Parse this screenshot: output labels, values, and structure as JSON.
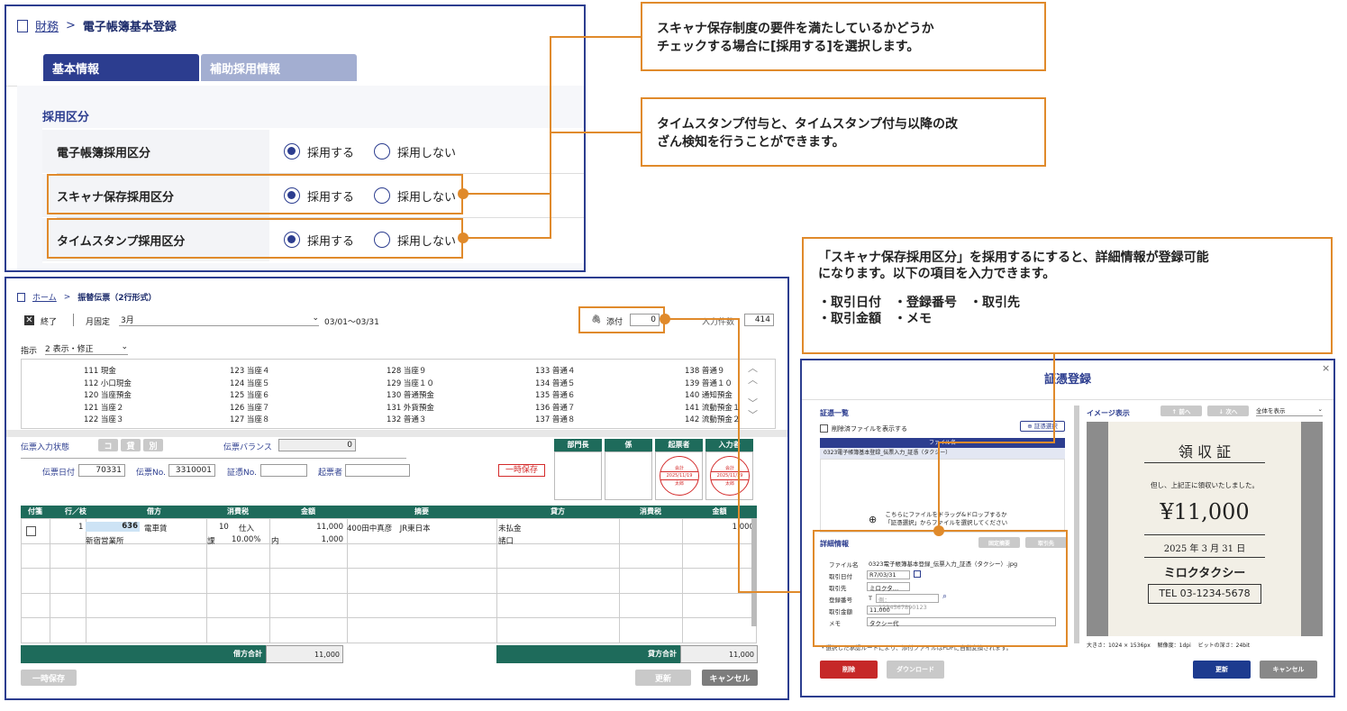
{
  "top_panel": {
    "breadcrumb_parent": "財務",
    "breadcrumb_sep": ">",
    "breadcrumb_current": "電子帳簿基本登録",
    "tabs": [
      "基本情報",
      "補助採用情報"
    ],
    "section_title": "採用区分",
    "rows": [
      {
        "label": "電子帳簿採用区分",
        "opt1": "採用する",
        "opt2": "採用しない"
      },
      {
        "label": "スキャナ保存採用区分",
        "opt1": "採用する",
        "opt2": "採用しない"
      },
      {
        "label": "タイムスタンプ採用区分",
        "opt1": "採用する",
        "opt2": "採用しない"
      }
    ]
  },
  "callouts": {
    "c1": "スキャナ保存制度の要件を満たしているかどうか\nチェックする場合に[採用する]を選択します。",
    "c2": "タイムスタンプ付与と、タイムスタンプ付与以降の改\nざん検知を行うことができます。",
    "c3_line1": "「スキャナ保存採用区分」を採用するにすると、詳細情報が登録可能",
    "c3_line2": "になります。以下の項目を入力できます。",
    "c3_items_line1": "・取引日付　・登録番号　・取引先",
    "c3_items_line2": "・取引金額　・メモ"
  },
  "voucher": {
    "breadcrumb_home": "ホーム",
    "breadcrumb_sep": ">",
    "breadcrumb_current": "振替伝票（2行形式）",
    "end_label": "終了",
    "month_fixed_label": "月固定",
    "month_value": "3月",
    "date_range": "03/01〜03/31",
    "attach_label": "添付",
    "attach_count": "0",
    "input_count_label": "入力件数",
    "input_count": "414",
    "mode_label": "指示",
    "mode_value": "2 表示・修正",
    "accounts": [
      [
        "111 現金",
        "123 当座４",
        "128 当座９",
        "133 普通４",
        "138 普通９"
      ],
      [
        "112 小口現金",
        "124 当座５",
        "129 当座１０",
        "134 普通５",
        "139 普通１０"
      ],
      [
        "120 当座預金",
        "125 当座６",
        "130 普通預金",
        "135 普通６",
        "140 通知預金"
      ],
      [
        "121 当座２",
        "126 当座７",
        "131 外貨預金",
        "136 普通７",
        "141 流動預金１"
      ],
      [
        "122 当座３",
        "127 当座８",
        "132 普通３",
        "137 普通８",
        "142 流動預金２"
      ]
    ],
    "status_label": "伝票入力状態",
    "status_buttons": [
      "コ",
      "貸",
      "別"
    ],
    "balance_label": "伝票バランス",
    "balance_value": "0",
    "date_label": "伝票日付",
    "date_value": "70331",
    "no_label": "伝票No.",
    "no_value": "3310001",
    "evidence_no_label": "証憑No.",
    "originator_label": "起票者",
    "temp_save_tag": "一時保存",
    "approvers": [
      "部門長",
      "係",
      "起票者",
      "入力者"
    ],
    "stamp_date": "2025/11/19",
    "stamp_top": "会計",
    "stamp_bottom": "太郎",
    "table_headers": [
      "付箋",
      "行／枝",
      "借方",
      "消費税",
      "金額",
      "摘要",
      "貸方",
      "消費税",
      "金額"
    ],
    "row": {
      "line": "1",
      "debit_code": "636",
      "debit_name": "電車賃",
      "debit_sub": "新宿営業所",
      "tax_code": "10",
      "tax_type": "仕入",
      "tax_kbn": "課",
      "tax_rate": "10.00%",
      "tax_in": "内",
      "amount": "11,000",
      "amount2": "1,000",
      "memo": "400田中真彦　JR東日本",
      "credit_name": "未払金",
      "credit_sub": "諸口",
      "credit_amount": "1,000"
    },
    "debit_total_label": "借方合計",
    "debit_total": "11,000",
    "credit_total_label": "貸方合計",
    "credit_total": "11,000",
    "btn_temp_save": "一時保存",
    "btn_update": "更新",
    "btn_cancel": "キャンセル"
  },
  "evidence": {
    "title": "証憑登録",
    "list_title": "証憑一覧",
    "show_deleted": "削除済ファイルを表示する",
    "select_btn": "証憑選択",
    "col_file": "ファイル名",
    "file_row": "0323電子帳簿基本登録_伝票入力_証憑（タクシー）",
    "drop_text1": "こちらにファイルをドラッグ&ドロップするか",
    "drop_text2": "「証憑選択」からファイルを選択してください",
    "detail_title": "詳細情報",
    "detail_btn1": "固定摘要",
    "detail_btn2": "取引先",
    "fields": {
      "file_label": "ファイル名",
      "file_value": "0323電子帳簿基本登録_伝票入力_証憑（タクシー）.jpg",
      "date_label": "取引日付",
      "date_value": "R7/03/31",
      "partner_label": "取引先",
      "partner_value": "ミロクタ…",
      "reg_label": "登録番号",
      "reg_prefix": "T",
      "reg_placeholder": "例：1234567890123",
      "amount_label": "取引金額",
      "amount_value": "11,000",
      "memo_label": "メモ",
      "memo_value": "タクシー代"
    },
    "note": "・選択した承認ルートにより、添付ファイルはPDFに自動変換されます。",
    "btn_delete": "削除",
    "btn_download": "ダウンロード",
    "image_title": "イメージ表示",
    "prev": "↑ 前へ",
    "next": "↓ 次へ",
    "zoom": "全体を表示",
    "receipt": {
      "title": "領 収 証",
      "note": "但し、上記正に領収いたしました。",
      "amount": "¥11,000",
      "date": "2025 年 3 月 31 日",
      "company": "ミロクタクシー",
      "tel": "TEL 03-1234-5678"
    },
    "image_info": "大きさ：1024 × 1536px　 解像度：1dpi　 ビットの深さ：24bit",
    "btn_update": "更新",
    "btn_cancel": "キャンセル"
  },
  "colors": {
    "navy": "#2c3d8f",
    "orange": "#e08a2b",
    "green": "#1e6b5b",
    "red": "#c62828"
  }
}
